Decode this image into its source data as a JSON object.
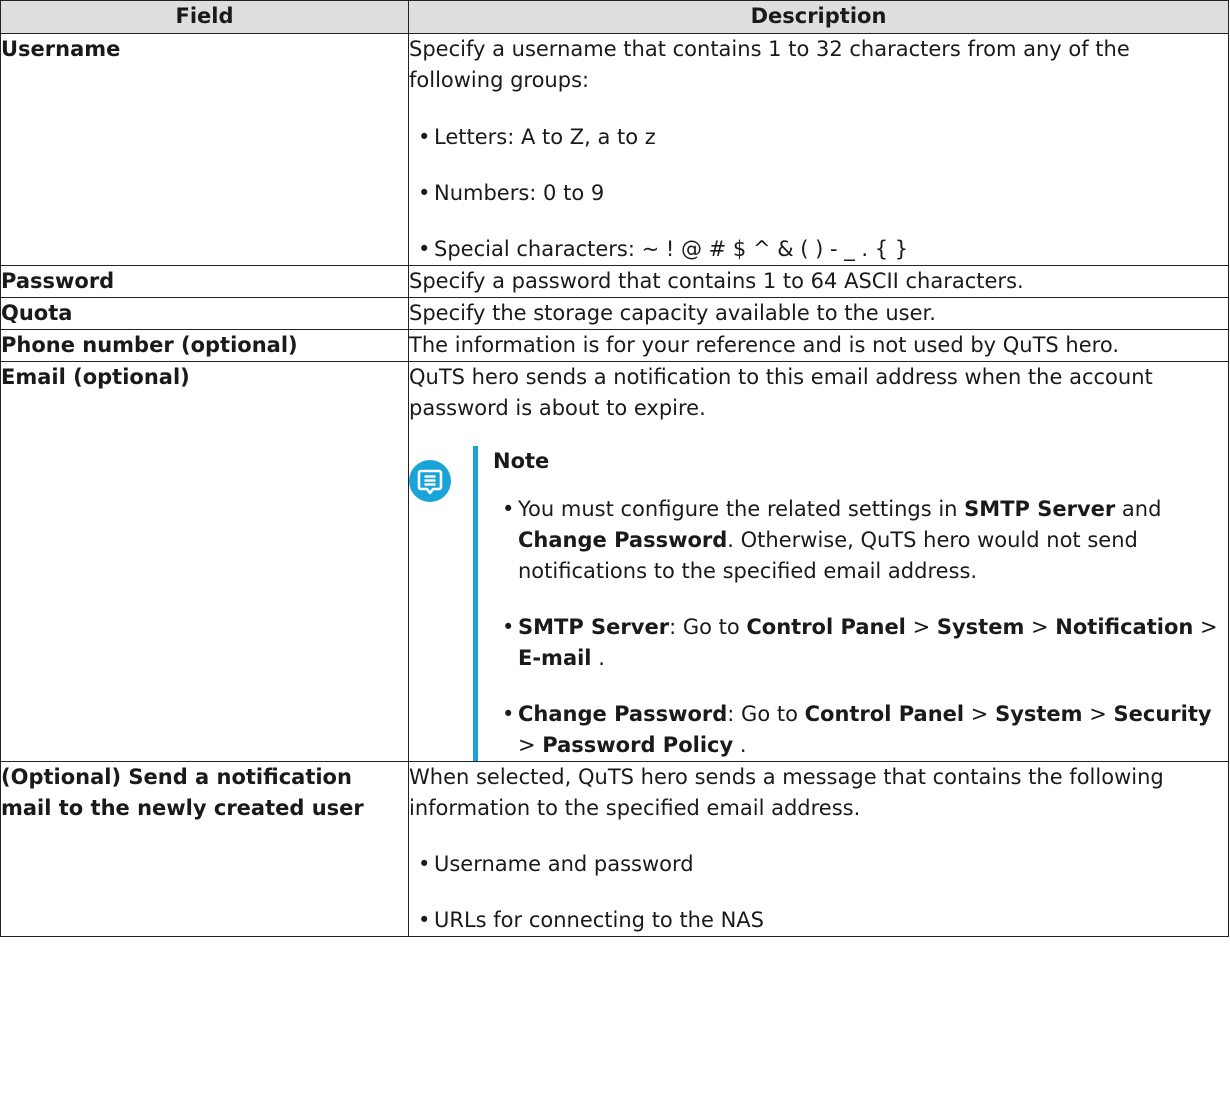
{
  "headers": {
    "field": "Field",
    "description": "Description"
  },
  "rows": {
    "username": {
      "field": "Username",
      "intro": "Specify a username that contains 1 to 32 characters from any of the following groups:",
      "items": [
        "Letters: A to Z, a to z",
        "Numbers: 0 to 9",
        "Special characters: ~ ! @ # $ ^ & ( ) - _ . { }"
      ]
    },
    "password": {
      "field": "Password",
      "description": "Specify a password that contains 1 to 64 ASCII characters."
    },
    "quota": {
      "field": "Quota",
      "description": "Specify the storage capacity available to the user."
    },
    "phone": {
      "field": "Phone number (optional)",
      "description": "The information is for your reference and is not used by QuTS hero."
    },
    "email": {
      "field": "Email (optional)",
      "description": "QuTS hero sends a notification to this email address when the account password is about to expire.",
      "note": {
        "title": "Note",
        "item1": {
          "t1": "You must configure the related settings in ",
          "b1": "SMTP Server",
          "t2": " and ",
          "b2": "Change Password",
          "t3": ". Otherwise, QuTS hero would not send notifications to the specified email address."
        },
        "item2": {
          "b1": "SMTP Server",
          "t1": ": Go to ",
          "b2": "Control Panel",
          "s1": " > ",
          "b3": "System",
          "s2": " > ",
          "b4": "Notification",
          "s3": " > ",
          "b5": "E-mail",
          "t2": " ."
        },
        "item3": {
          "b1": "Change Password",
          "t1": ": Go to ",
          "b2": "Control Panel",
          "s1": " > ",
          "b3": "System",
          "s2": " > ",
          "b4": "Security",
          "s3": " > ",
          "b5": "Password Policy",
          "t2": " ."
        }
      }
    },
    "notify": {
      "field": "(Optional) Send a notification mail to the newly created user",
      "intro": "When selected, QuTS hero sends a message that contains the following information to the specified email address.",
      "items": [
        "Username and password",
        "URLs for connecting to the NAS"
      ]
    }
  },
  "icons": {
    "note": "note-message-icon"
  },
  "colors": {
    "header_bg": "#dedede",
    "note_accent": "#1aa3d8",
    "border": "#222222"
  }
}
